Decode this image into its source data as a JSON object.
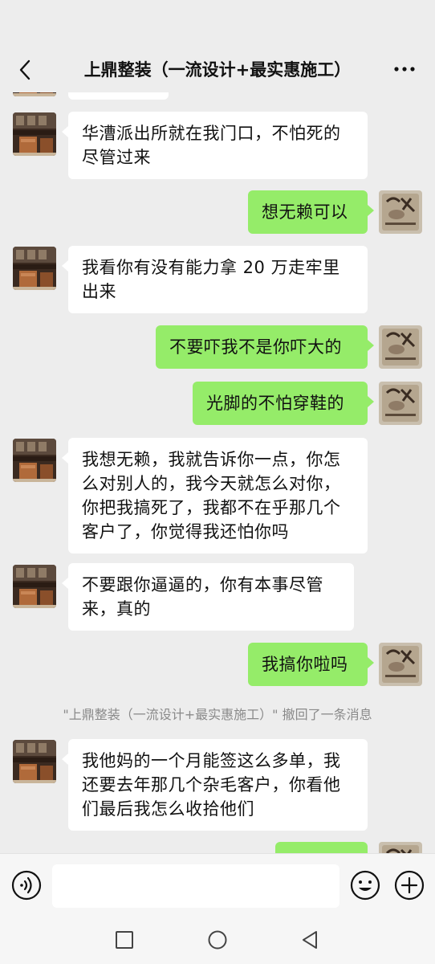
{
  "header": {
    "title": "上鼎整装（一流设计+最实惠施工）",
    "back_icon": "chevron-left-icon",
    "more_icon": "more-dots-icon"
  },
  "messages": [
    {
      "side": "left",
      "text": "华漕派出所就在我门口，不怕死的尽管过来"
    },
    {
      "side": "right",
      "text": "想无赖可以"
    },
    {
      "side": "left",
      "text": "我看你有没有能力拿 20 万走牢里出来"
    },
    {
      "side": "right",
      "text": "不要吓我不是你吓大的"
    },
    {
      "side": "right",
      "text": "光脚的不怕穿鞋的"
    },
    {
      "side": "left",
      "text": "我想无赖，我就告诉你一点，你怎么对别人的，我今天就怎么对你，你把我搞死了，我都不在乎那几个客户了，你觉得我还怕你吗"
    },
    {
      "side": "left",
      "text": "不要跟你逼逼的，你有本事尽管来，真的"
    },
    {
      "side": "right",
      "text": "我搞你啦吗"
    },
    {
      "side": "left",
      "text": "我他妈的一个月能签这么多单，我还要去年那几个杂毛客户，你看他们最后我怎么收拾他们"
    }
  ],
  "system_message": "\"上鼎整装（一流设计+最实惠施工）\" 撤回了一条消息",
  "input_bar": {
    "placeholder": "",
    "voice_icon": "voice-icon",
    "emoji_icon": "emoji-icon",
    "plus_icon": "plus-icon"
  },
  "navbar": {
    "recent_icon": "square-icon",
    "home_icon": "circle-icon",
    "back_icon": "triangle-back-icon"
  },
  "colors": {
    "background": "#ededed",
    "incoming_bubble": "#ffffff",
    "outgoing_bubble": "#95ec69",
    "system_text": "#8a8a8a"
  }
}
